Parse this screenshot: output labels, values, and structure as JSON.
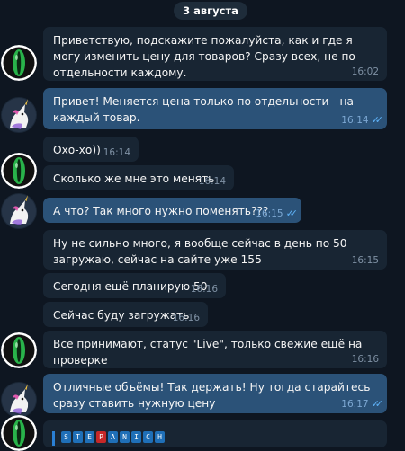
{
  "date_separator": "3 августа",
  "messages": [
    {
      "dir": "in",
      "text": "Приветствую, подскажите пожалуйста, как и где я могу изменить цену для товаров? Сразу всех, не по отдельности каждому.",
      "time": "16:02"
    },
    {
      "dir": "out",
      "text": "Привет! Меняется цена только по отдельности - на каждый товар.",
      "time": "16:14",
      "read": true
    },
    {
      "dir": "in",
      "text": "Охо-хо))",
      "time": "16:14"
    },
    {
      "dir": "in",
      "text": "Сколько же мне это менять",
      "time": "16:14"
    },
    {
      "dir": "out",
      "text": "А что? Так много нужно поменять???",
      "time": "16:15",
      "read": true
    },
    {
      "dir": "in",
      "text": "Ну не сильно много, я вообще сейчас в день по 50 загружаю, сейчас на сайте уже 155",
      "time": "16:15"
    },
    {
      "dir": "in",
      "text": "Сегодня ещё планирую 50",
      "time": "16:16"
    },
    {
      "dir": "in",
      "text": "Сейчас буду загружать",
      "time": "16:16"
    },
    {
      "dir": "in",
      "text": "Все принимают, статус \"Live\", только свежие ещё на проверке",
      "time": "16:16"
    },
    {
      "dir": "out",
      "text": "Отличные объёмы! Так держать!   Ну тогда старайтесь сразу ставить нужную цену",
      "time": "16:17",
      "read": true
    }
  ],
  "avatars": {
    "client": "green-eye-icon",
    "support": "unicorn-icon"
  },
  "banner": {
    "letters": [
      "S",
      "T",
      "E",
      "P",
      "A",
      "N",
      "I",
      "C",
      "H"
    ],
    "highlight_index": 3
  },
  "colors": {
    "background": "#0e1621",
    "incoming_bubble": "#182533",
    "outgoing_bubble": "#2b5278",
    "read_ticks": "#5fb2f7"
  }
}
